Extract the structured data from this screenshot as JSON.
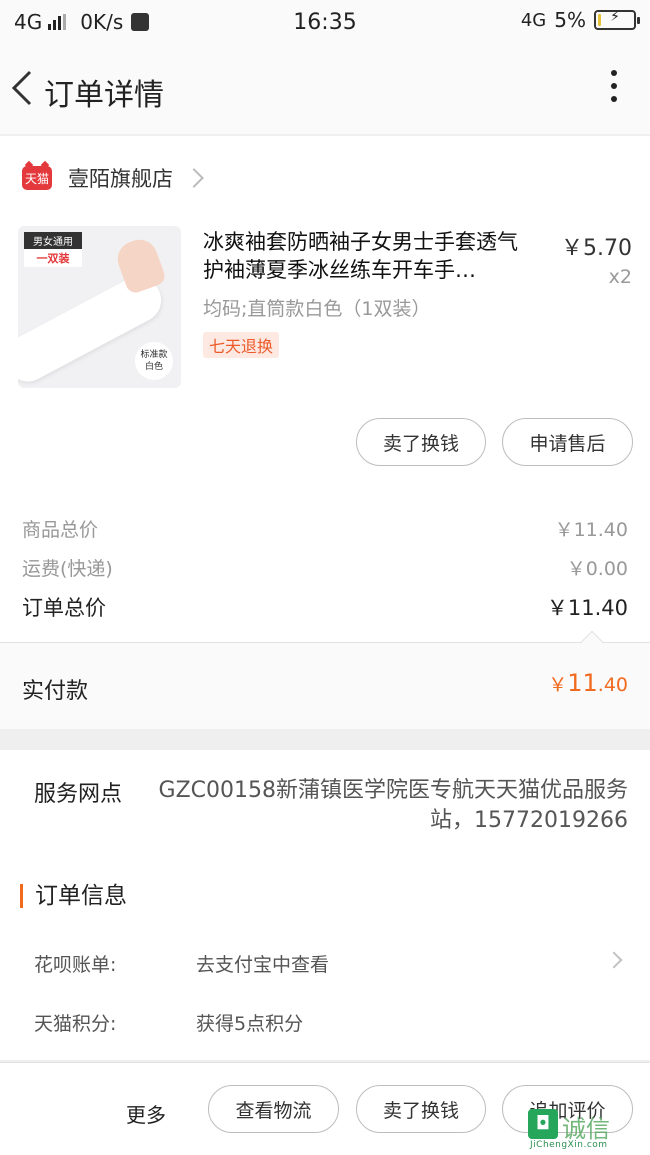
{
  "status_bar": {
    "network_left": "4G",
    "speed": "0K/s",
    "time": "16:35",
    "network_right": "4G",
    "battery": "5%",
    "battery_level": 0.05
  },
  "header": {
    "title": "订单详情"
  },
  "shop": {
    "badge": "天猫",
    "name": "壹陌旗舰店"
  },
  "product": {
    "thumb_tag_top": "男女通用",
    "thumb_tag_bottom": "一双装",
    "thumb_badge_1": "标准款",
    "thumb_badge_2": "白色",
    "title": "冰爽袖套防晒袖子女男士手套透气护袖薄夏季冰丝练车开车手…",
    "price": "￥5.70",
    "quantity": "x2",
    "spec": "均码;直筒款白色（1双装）",
    "tag": "七天退换"
  },
  "item_buttons": {
    "sell": "卖了换钱",
    "after_sale": "申请售后"
  },
  "summary": {
    "goods_label": "商品总价",
    "goods_value": "￥11.40",
    "shipping_label": "运费(快递)",
    "shipping_value": "￥0.00",
    "total_label": "订单总价",
    "total_value": "￥11.40",
    "paid_label": "实付款",
    "paid_symbol": "￥",
    "paid_int": "11",
    "paid_dec": ".40"
  },
  "service": {
    "label": "服务网点",
    "text": "GZC00158新蒲镇医学院医专航天天猫优品服务站，15772019266"
  },
  "order_info": {
    "title": "订单信息",
    "rows": [
      {
        "key": "花呗账单:",
        "value": "去支付宝中查看"
      },
      {
        "key": "天猫积分:",
        "value": "获得5点积分"
      }
    ]
  },
  "bottom_bar": {
    "more": "更多",
    "logistics": "查看物流",
    "sell": "卖了换钱",
    "review": "追加评价"
  },
  "watermark": {
    "text": "诚信",
    "sub": "JiChengXin.com"
  }
}
